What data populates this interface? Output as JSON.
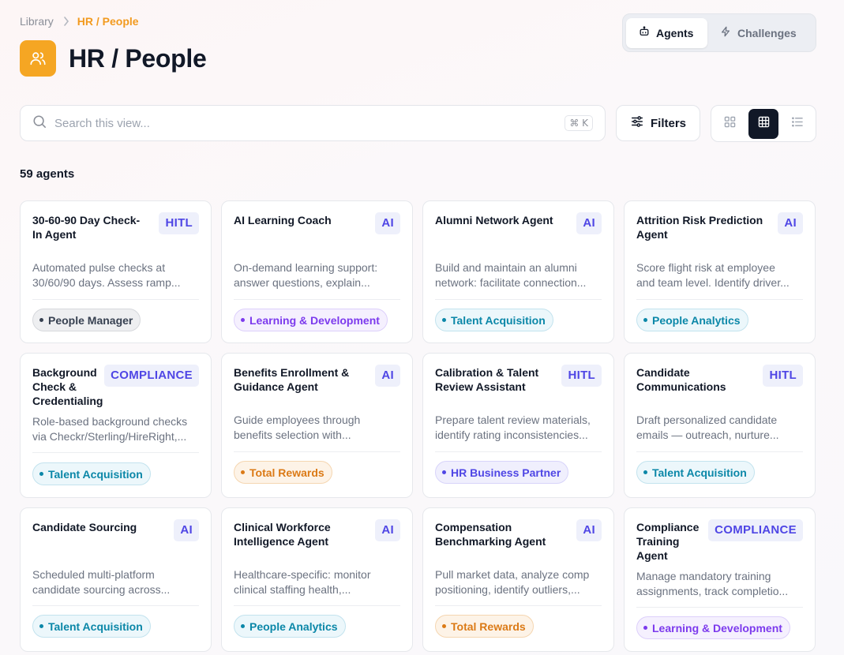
{
  "breadcrumb": {
    "library": "Library",
    "current": "HR / People"
  },
  "page_title": "HR / People",
  "tabs": [
    {
      "label": "Agents",
      "icon": "robot-icon",
      "active": true
    },
    {
      "label": "Challenges",
      "icon": "lightning-icon",
      "active": false
    }
  ],
  "search": {
    "placeholder": "Search this view...",
    "value": "",
    "shortcut": "⌘ K"
  },
  "filters_label": "Filters",
  "view_modes": [
    "grid-small",
    "grid-large",
    "list"
  ],
  "active_view": "grid-large",
  "count_label": "59 agents",
  "colors": {
    "accent_orange": "#f5a623",
    "badge_indigo": "#4f46e5",
    "tag_gray": "#374151",
    "tag_purple": "#7c3aed",
    "tag_teal": "#0b87a8",
    "tag_orange": "#db7a16"
  },
  "cards": [
    {
      "title1": "30-60-90 Day Check-",
      "title2": "In Agent",
      "title3": "",
      "badge": "HITL",
      "desc1": "Automated pulse checks at",
      "desc2": "30/60/90 days. Assess ramp...",
      "tag": "People Manager",
      "tag_color": "gray"
    },
    {
      "title1": "AI Learning Coach",
      "title2": "",
      "title3": "",
      "badge": "AI",
      "desc1": "On-demand learning support:",
      "desc2": "answer questions, explain...",
      "tag": "Learning & Development",
      "tag_color": "purple"
    },
    {
      "title1": "Alumni Network Agent",
      "title2": "",
      "title3": "",
      "badge": "AI",
      "desc1": "Build and maintain an alumni",
      "desc2": "network: facilitate connection...",
      "tag": "Talent Acquisition",
      "tag_color": "teal"
    },
    {
      "title1": "Attrition Risk Prediction",
      "title2": "Agent",
      "title3": "",
      "badge": "AI",
      "desc1": "Score flight risk at employee",
      "desc2": "and team level. Identify driver...",
      "tag": "People Analytics",
      "tag_color": "teal"
    },
    {
      "title1": "Background",
      "title2": "Check &",
      "title3": "Credentialing",
      "badge": "COMPLIANCE",
      "desc1": "Role-based background checks",
      "desc2": "via Checkr/Sterling/HireRight,...",
      "tag": "Talent Acquisition",
      "tag_color": "teal"
    },
    {
      "title1": "Benefits Enrollment &",
      "title2": "Guidance Agent",
      "title3": "",
      "badge": "AI",
      "desc1": "Guide employees through",
      "desc2": "benefits selection with...",
      "tag": "Total Rewards",
      "tag_color": "orange"
    },
    {
      "title1": "Calibration & Talent",
      "title2": "Review Assistant",
      "title3": "",
      "badge": "HITL",
      "desc1": "Prepare talent review materials,",
      "desc2": "identify rating inconsistencies...",
      "tag": "HR Business Partner",
      "tag_color": "indigo"
    },
    {
      "title1": "Candidate",
      "title2": "Communications",
      "title3": "",
      "badge": "HITL",
      "desc1": "Draft personalized candidate",
      "desc2": "emails — outreach, nurture...",
      "tag": "Talent Acquisition",
      "tag_color": "teal"
    },
    {
      "title1": "Candidate Sourcing",
      "title2": "",
      "title3": "",
      "badge": "AI",
      "desc1": "Scheduled multi-platform",
      "desc2": "candidate sourcing across...",
      "tag": "Talent Acquisition",
      "tag_color": "teal"
    },
    {
      "title1": "Clinical Workforce",
      "title2": "Intelligence Agent",
      "title3": "",
      "badge": "AI",
      "desc1": "Healthcare-specific: monitor",
      "desc2": "clinical staffing health,...",
      "tag": "People Analytics",
      "tag_color": "teal"
    },
    {
      "title1": "Compensation",
      "title2": "Benchmarking Agent",
      "title3": "",
      "badge": "AI",
      "desc1": "Pull market data, analyze comp",
      "desc2": "positioning, identify outliers,...",
      "tag": "Total Rewards",
      "tag_color": "orange"
    },
    {
      "title1": "Compliance",
      "title2": "Training",
      "title3": "Agent",
      "badge": "COMPLIANCE",
      "desc1": "Manage mandatory training",
      "desc2": "assignments, track completio...",
      "tag": "Learning & Development",
      "tag_color": "purple"
    }
  ]
}
